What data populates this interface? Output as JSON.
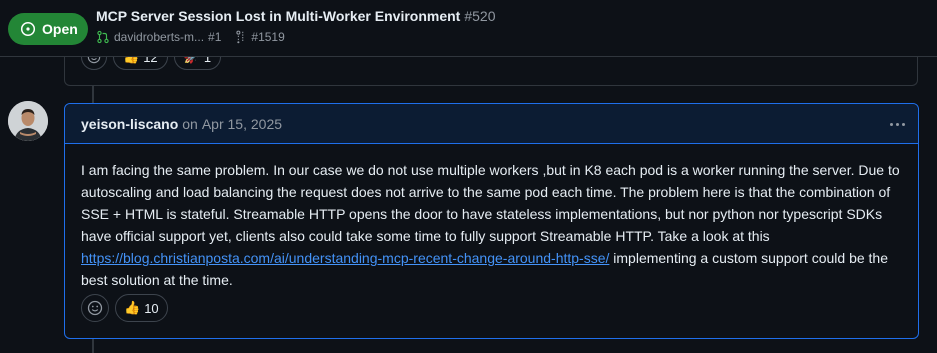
{
  "header": {
    "state_label": "Open",
    "title": "MCP Server Session Lost in Multi-Worker Environment",
    "number": "#520",
    "pr_author": "davidroberts-m...",
    "pr_number": "#1",
    "linked_issue": "#1519"
  },
  "previous_comment": {
    "reactions": [
      {
        "emoji": "👍",
        "count": "12"
      },
      {
        "emoji": "🚀",
        "count": "1"
      }
    ]
  },
  "comment": {
    "author": "yeison-liscano",
    "date_prefix": "on",
    "date": "Apr 15, 2025",
    "body_p1": "I am facing the same problem. In our case we do not use multiple workers ,but in K8 each pod is a worker running the server. Due to autoscaling and load balancing the request does not arrive to the same pod each time. The problem here is that the combination of SSE + HTML is stateful. Streamable HTTP opens the door to have stateless implementations, but nor python nor typescript SDKs have official support yet, clients also could take some time to fully support Streamable HTTP. Take a look at this",
    "link_text": "https://blog.christianposta.com/ai/understanding-mcp-recent-change-around-http-sse/",
    "body_p2": "implementing a custom support could be the best solution at the time.",
    "reactions": [
      {
        "emoji": "👍",
        "count": "10"
      }
    ]
  },
  "colors": {
    "open_badge": "#238636",
    "link": "#4493f8",
    "highlight_border": "#1f6feb",
    "background": "#0d1117"
  }
}
